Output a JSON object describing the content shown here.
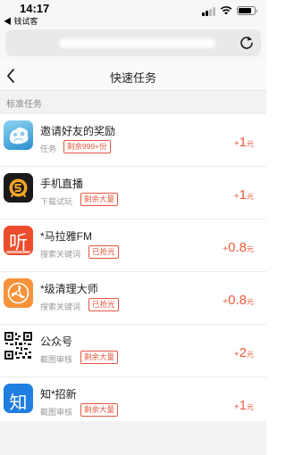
{
  "status_bar": {
    "time": "14:17",
    "back_app": "◀ 钱试客",
    "battery_level": 0.85
  },
  "browser": {
    "reload_icon": "reload-icon"
  },
  "nav": {
    "title": "快速任务",
    "back_icon": "chevron-left-icon"
  },
  "section": {
    "label": "标准任务"
  },
  "colors": {
    "accent": "#ec5c3c",
    "badge": "#e4593f"
  },
  "tasks": [
    {
      "name": "邀请好友的奖励",
      "type": "任务",
      "badge": "剩余999+份",
      "reward": "1",
      "plus": "+",
      "unit": "元",
      "icon": "invite-friends-icon"
    },
    {
      "name": "手机直播",
      "type": "下载试玩",
      "badge": "剩余大量",
      "reward": "1",
      "plus": "+",
      "unit": "元",
      "icon": "live-stream-app-icon"
    },
    {
      "name": "*马拉雅FM",
      "type": "搜索关键词",
      "badge": "已抢光",
      "reward": "0.8",
      "plus": "+",
      "unit": "元",
      "icon": "ting-fm-app-icon",
      "icon_text": "听"
    },
    {
      "name": "*级清理大师",
      "type": "搜索关键词",
      "badge": "已抢光",
      "reward": "0.8",
      "plus": "+",
      "unit": "元",
      "icon": "cleaner-fan-icon"
    },
    {
      "name": "公众号",
      "type": "截图审核",
      "badge": "剩余大量",
      "reward": "2",
      "plus": "+",
      "unit": "元",
      "icon": "qr-code-icon"
    },
    {
      "name": "知*招新",
      "type": "截图审核",
      "badge": "剩余大量",
      "reward": "1",
      "plus": "+",
      "unit": "元",
      "icon": "zhi-app-icon",
      "icon_text": "知"
    }
  ]
}
